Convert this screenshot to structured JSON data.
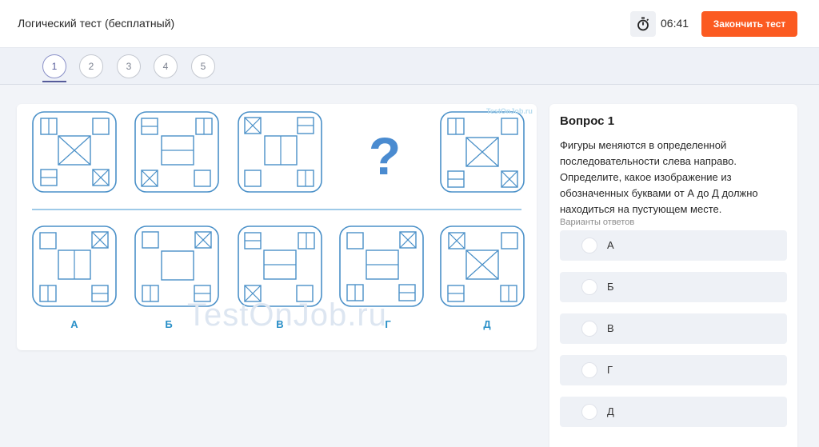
{
  "header": {
    "title": "Логический тест (бесплатный)",
    "timer_icon": "stopwatch-icon",
    "timer": "06:41",
    "finish_label": "Закончить тест"
  },
  "steps": [
    {
      "label": "1",
      "active": true
    },
    {
      "label": "2",
      "active": false
    },
    {
      "label": "3",
      "active": false
    },
    {
      "label": "4",
      "active": false
    },
    {
      "label": "5",
      "active": false
    }
  ],
  "puzzle": {
    "missing_mark": "?",
    "watermark_small": "TestOnJob.ru",
    "watermark_big": "TestOnJob.ru",
    "answer_letters": [
      "А",
      "Б",
      "В",
      "Г",
      "Д"
    ],
    "line_color": "#4a90c8",
    "accent_color": "#2a90c8"
  },
  "question": {
    "title": "Вопрос 1",
    "text": "Фигуры меняются в определенной последовательности слева направо. Определите, какое изображение из обозначенных буквами от А до Д должно находиться на пустующем месте.",
    "options_label": "Варианты ответов",
    "options": [
      "А",
      "Б",
      "В",
      "Г",
      "Д"
    ]
  },
  "colors": {
    "finish_button": "#fb5a21",
    "active_step": "#555b9a",
    "figure_stroke": "#4a90c8"
  }
}
